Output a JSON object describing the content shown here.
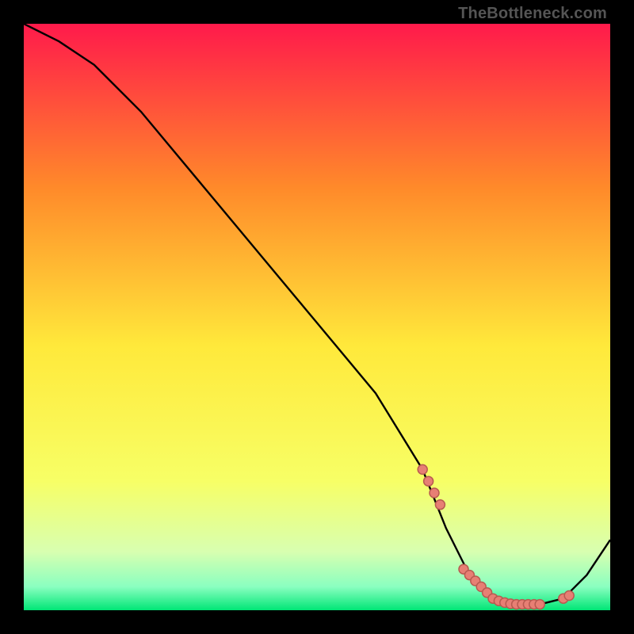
{
  "watermark": "TheBottleneck.com",
  "colors": {
    "top": "#ff1a4b",
    "mid1": "#ff8a2a",
    "mid2": "#ffe93b",
    "mid3": "#f7ff66",
    "low1": "#d8ffb0",
    "low2": "#8affc0",
    "bottom": "#00e676",
    "curve": "#000000",
    "dot_fill": "#e77f74",
    "dot_stroke": "#b85a50"
  },
  "chart_data": {
    "type": "line",
    "title": "",
    "xlabel": "",
    "ylabel": "",
    "xlim": [
      0,
      100
    ],
    "ylim": [
      0,
      100
    ],
    "series": [
      {
        "name": "bottleneck-curve",
        "x": [
          0,
          6,
          12,
          20,
          30,
          40,
          50,
          60,
          68,
          72,
          76,
          80,
          84,
          88,
          92,
          96,
          100
        ],
        "values": [
          100,
          97,
          93,
          85,
          73,
          61,
          49,
          37,
          24,
          14,
          6,
          2,
          1,
          1,
          2,
          6,
          12
        ]
      }
    ],
    "highlight_points": {
      "name": "optimal-range-dots",
      "x": [
        68,
        69,
        70,
        71,
        75,
        76,
        77,
        78,
        79,
        80,
        81,
        82,
        83,
        84,
        85,
        86,
        87,
        88,
        92,
        93
      ],
      "values": [
        24,
        22,
        20,
        18,
        7,
        6,
        5,
        4,
        3,
        2,
        1.6,
        1.3,
        1.1,
        1,
        1,
        1,
        1,
        1,
        2,
        2.5
      ]
    }
  }
}
